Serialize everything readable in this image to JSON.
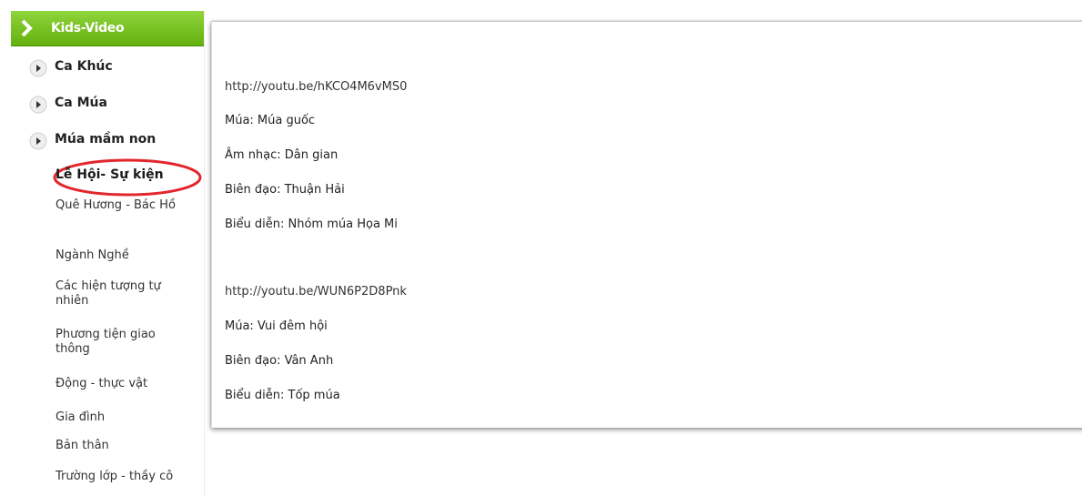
{
  "sidebar": {
    "header_title": "Kids-Video",
    "menu": [
      {
        "label": "Ca Khúc"
      },
      {
        "label": "Ca Múa"
      },
      {
        "label": "Múa mầm non"
      }
    ],
    "sub_items": [
      {
        "label": "Lễ Hội- Sự kiện",
        "active": true
      },
      {
        "label": "Quê Hương - Bác Hồ"
      },
      {
        "label": "Ngành Nghề"
      },
      {
        "label": "Các hiện tượng tự nhiên"
      },
      {
        "label": "Phương tiện giao thông"
      },
      {
        "label": "Động - thực vật"
      },
      {
        "label": "Gia đình"
      },
      {
        "label": "Bản thân"
      },
      {
        "label": "Trường lớp - thầy cô"
      }
    ]
  },
  "content": {
    "videos": [
      {
        "url": "http://youtu.be/hKCO4M6vMS0",
        "lines": [
          "Múa: Múa guốc",
          "Âm nhạc: Dân gian",
          "Biên đạo: Thuận Hải",
          "Biểu diễn: Nhóm múa Họa Mi"
        ]
      },
      {
        "url": "http://youtu.be/WUN6P2D8Pnk",
        "lines": [
          "Múa: Vui đêm hội",
          "Biên đạo: Vân Anh",
          "Biểu diễn: Tốp múa"
        ]
      }
    ]
  },
  "colors": {
    "header_green": "#64b10f",
    "highlight_red": "#e3262d",
    "bullet_grey": "#8a8a8a"
  }
}
